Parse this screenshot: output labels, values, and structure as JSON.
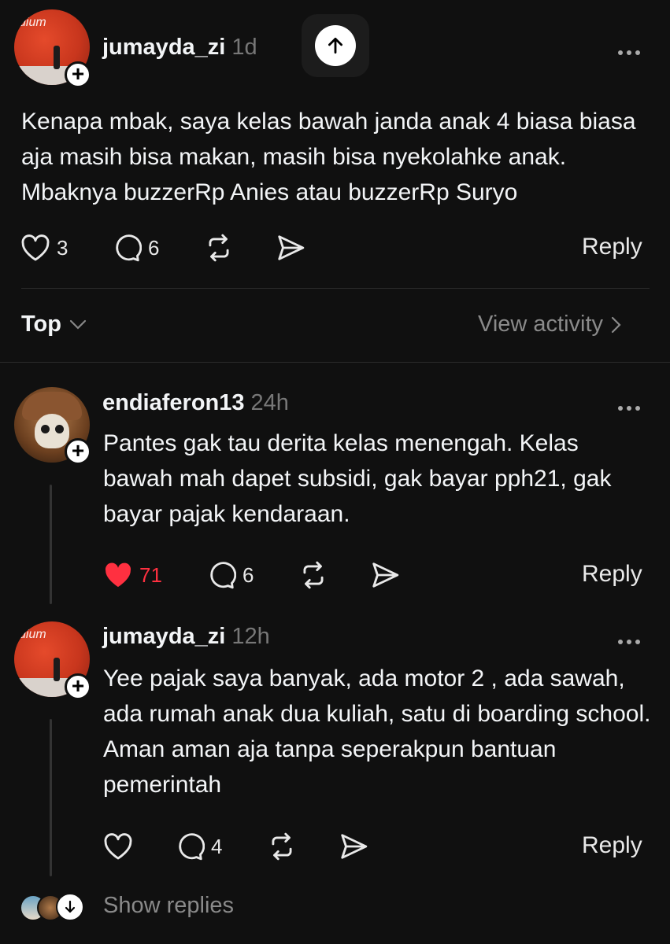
{
  "post": {
    "username": "jumayda_zi",
    "time": "1d",
    "avatar_text": "dium",
    "text": "Kenapa mbak, saya kelas bawah janda anak 4 biasa biasa aja masih bisa makan, masih bisa nyekolahke anak. Mbaknya buzzerRp Anies atau buzzerRp Suryo",
    "likes": "3",
    "comments": "6",
    "reply_label": "Reply"
  },
  "sort": {
    "label": "Top",
    "view_activity": "View activity"
  },
  "replies": [
    {
      "username": "endiaferon13",
      "time": "24h",
      "text": "Pantes gak tau derita kelas menengah. Kelas bawah mah dapet subsidi, gak bayar pph21, gak bayar pajak kendaraan.",
      "likes": "71",
      "liked": true,
      "comments": "6",
      "reply_label": "Reply"
    },
    {
      "username": "jumayda_zi",
      "time": "12h",
      "avatar_text": "dium",
      "text": "Yee pajak saya banyak, ada motor 2 , ada sawah, ada rumah anak dua kuliah, satu di boarding school. Aman aman aja tanpa seperakpun bantuan pemerintah",
      "likes": "",
      "liked": false,
      "comments": "4",
      "reply_label": "Reply"
    }
  ],
  "show_replies": "Show replies",
  "colors": {
    "background": "#101010",
    "text": "#f3f5f7",
    "muted": "#777777",
    "like_red": "#ff3040"
  }
}
